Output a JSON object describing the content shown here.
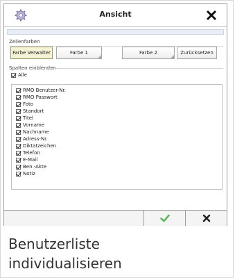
{
  "dialog": {
    "title": "Ansicht",
    "close_label": "✕"
  },
  "row_colors": {
    "label": "Zeilenfarben",
    "buttons": [
      "Farbe Verwalter",
      "Farbe 1",
      "Farbe 2",
      "Zurücksetzen"
    ]
  },
  "columns": {
    "label": "Spalten einblenden",
    "all_label": "Alle",
    "items": [
      "RMO Benutzer-Nr.",
      "RMO Passwort",
      "Foto",
      "Standort",
      "Titel",
      "Vorname",
      "Nachname",
      "Adress-Nr.",
      "Diktatzeichen",
      "Telefon",
      "E-Mail",
      "Ben.-Akte",
      "Notiz"
    ]
  },
  "footer": {
    "confirm_icon": "check-icon",
    "cancel_icon": "cross-icon"
  },
  "caption": {
    "line1": "Benutzerliste",
    "line2": "individualisieren"
  },
  "colors": {
    "confirm": "#5cb85c",
    "cancel": "#222222",
    "active_button": "#f5f2d6"
  }
}
